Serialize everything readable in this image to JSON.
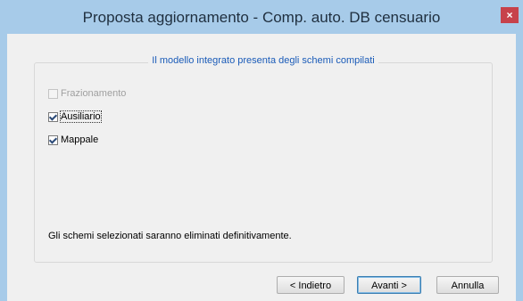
{
  "window": {
    "title": "Proposta aggiornamento - Comp. auto. DB censuario",
    "close_label": "×"
  },
  "group": {
    "legend": "Il modello integrato presenta degli schemi compilati"
  },
  "checkboxes": [
    {
      "label": "Frazionamento",
      "checked": false,
      "enabled": false
    },
    {
      "label": "Ausiliario",
      "checked": true,
      "enabled": true
    },
    {
      "label": "Mappale",
      "checked": true,
      "enabled": true
    }
  ],
  "info_text": "Gli schemi selezionati saranno eliminati definitivamente.",
  "buttons": {
    "back": "< Indietro",
    "next": "Avanti >",
    "cancel": "Annulla"
  }
}
